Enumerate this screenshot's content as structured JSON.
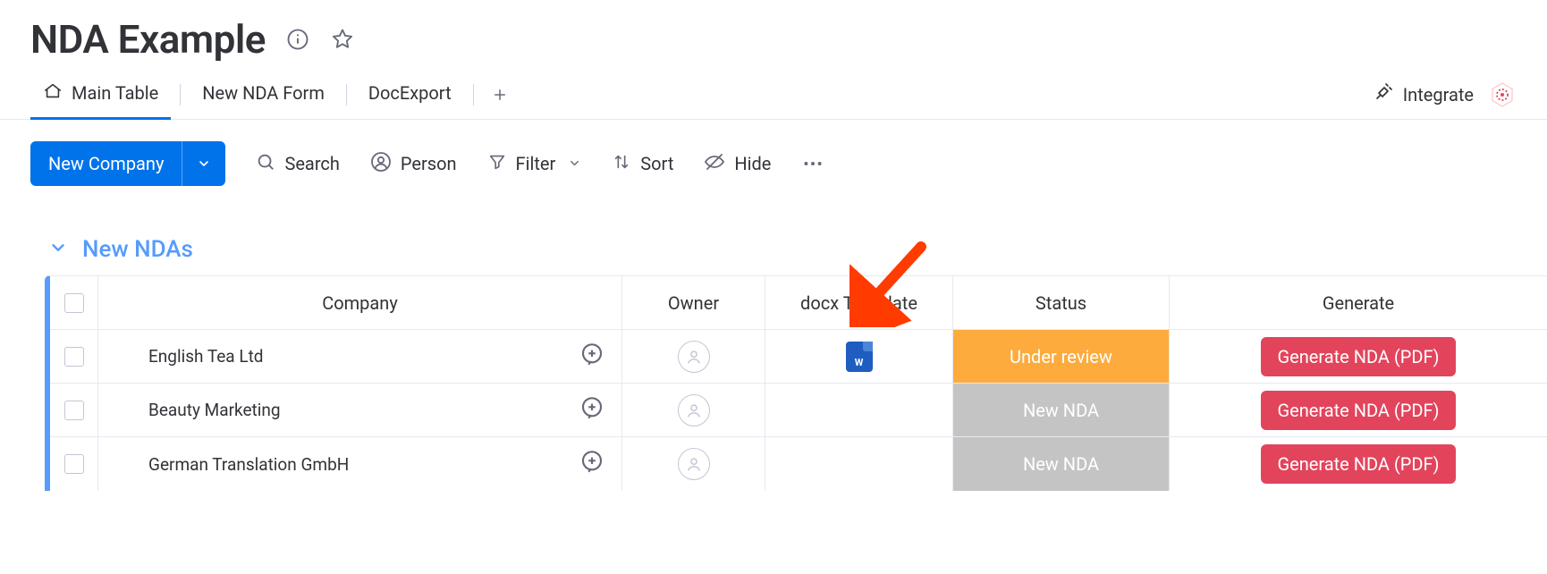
{
  "header": {
    "title": "NDA Example"
  },
  "tabs": {
    "items": [
      {
        "label": "Main Table",
        "active": true,
        "has_icon": true
      },
      {
        "label": "New NDA Form",
        "active": false,
        "has_icon": false
      },
      {
        "label": "DocExport",
        "active": false,
        "has_icon": false
      }
    ],
    "integrate_label": "Integrate"
  },
  "toolbar": {
    "new_button_label": "New Company",
    "search_label": "Search",
    "person_label": "Person",
    "filter_label": "Filter",
    "sort_label": "Sort",
    "hide_label": "Hide"
  },
  "group": {
    "title": "New NDAs",
    "columns": {
      "company": "Company",
      "owner": "Owner",
      "docx": "docx Template",
      "status": "Status",
      "generate": "Generate"
    },
    "rows": [
      {
        "company": "English Tea Ltd",
        "has_docx": true,
        "docx_label": "W",
        "status_label": "Under review",
        "status_class": "status-underreview",
        "generate_label": "Generate NDA (PDF)"
      },
      {
        "company": "Beauty Marketing",
        "has_docx": false,
        "docx_label": "",
        "status_label": "New NDA",
        "status_class": "status-newnda",
        "generate_label": "Generate NDA (PDF)"
      },
      {
        "company": "German Translation GmbH",
        "has_docx": false,
        "docx_label": "",
        "status_label": "New NDA",
        "status_class": "status-newnda",
        "generate_label": "Generate NDA (PDF)"
      }
    ]
  },
  "annotation": {
    "arrow_color": "#ff3b00"
  }
}
